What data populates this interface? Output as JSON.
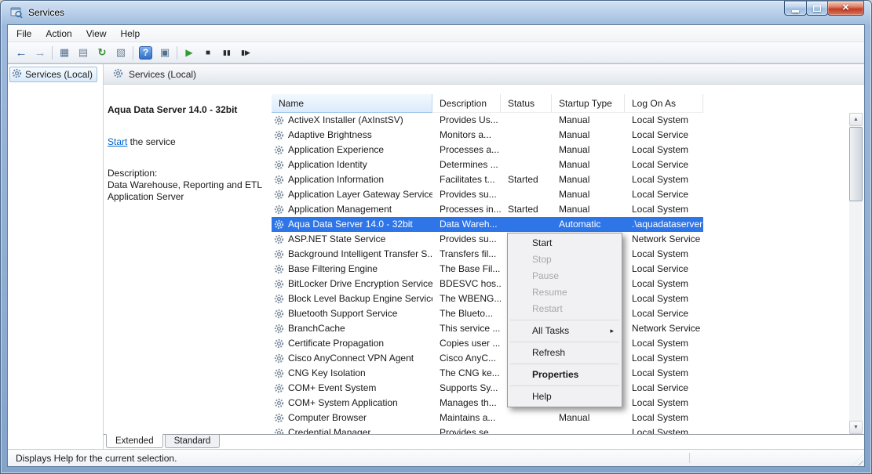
{
  "colors": {
    "selection": "#2e76e8",
    "link": "#0066cc"
  },
  "window": {
    "title": "Services"
  },
  "menu_bar": {
    "items": [
      "File",
      "Action",
      "View",
      "Help"
    ]
  },
  "toolbar": {
    "icons": [
      {
        "name": "back-icon",
        "glyph": "←",
        "color": "#2c5f9e"
      },
      {
        "name": "forward-icon",
        "glyph": "→",
        "color": "#8fa3b8"
      },
      {
        "name": "separator"
      },
      {
        "name": "show-console-tree-icon",
        "glyph": "▦",
        "color": "#55718f"
      },
      {
        "name": "export-list-icon",
        "glyph": "▤",
        "color": "#6d8097"
      },
      {
        "name": "refresh-icon",
        "glyph": "↻",
        "color": "#2e8b2e"
      },
      {
        "name": "properties-icon",
        "glyph": "▧",
        "color": "#6d8097"
      },
      {
        "name": "separator"
      },
      {
        "name": "help-icon",
        "glyph": "?",
        "color": "#ffffff"
      },
      {
        "name": "display-icon",
        "glyph": "▣",
        "color": "#55718f"
      },
      {
        "name": "separator"
      },
      {
        "name": "start-service-icon",
        "glyph": "▶",
        "color": "#2f9e2f"
      },
      {
        "name": "stop-service-icon",
        "glyph": "■",
        "color": "#2b2b2b"
      },
      {
        "name": "pause-service-icon",
        "glyph": "▮▮",
        "color": "#2b2b2b"
      },
      {
        "name": "restart-service-icon",
        "glyph": "▮▶",
        "color": "#2b2b2b"
      }
    ]
  },
  "console_tree": {
    "root_label": "Services (Local)"
  },
  "panel": {
    "header": "Services (Local)",
    "info": {
      "title": "Aqua Data Server 14.0 - 32bit",
      "action_link": "Start",
      "action_rest": " the service",
      "description_label": "Description:",
      "description_text": "Data Warehouse, Reporting and ETL Application Server"
    }
  },
  "table": {
    "columns": [
      {
        "label": "Name",
        "sorted": true
      },
      {
        "label": "Description"
      },
      {
        "label": "Status"
      },
      {
        "label": "Startup Type"
      },
      {
        "label": "Log On As"
      }
    ],
    "selected_index": 7,
    "rows": [
      {
        "name": "ActiveX Installer (AxInstSV)",
        "description": "Provides Us...",
        "status": "",
        "startup": "Manual",
        "logon": "Local System"
      },
      {
        "name": "Adaptive Brightness",
        "description": "Monitors a...",
        "status": "",
        "startup": "Manual",
        "logon": "Local Service"
      },
      {
        "name": "Application Experience",
        "description": "Processes a...",
        "status": "",
        "startup": "Manual",
        "logon": "Local System"
      },
      {
        "name": "Application Identity",
        "description": "Determines ...",
        "status": "",
        "startup": "Manual",
        "logon": "Local Service"
      },
      {
        "name": "Application Information",
        "description": "Facilitates t...",
        "status": "Started",
        "startup": "Manual",
        "logon": "Local System"
      },
      {
        "name": "Application Layer Gateway Service",
        "description": "Provides su...",
        "status": "",
        "startup": "Manual",
        "logon": "Local Service"
      },
      {
        "name": "Application Management",
        "description": "Processes in...",
        "status": "Started",
        "startup": "Manual",
        "logon": "Local System"
      },
      {
        "name": "Aqua Data Server 14.0 - 32bit",
        "description": "Data Wareh...",
        "status": "",
        "startup": "Automatic",
        "logon": ".\\aquadataserver"
      },
      {
        "name": "ASP.NET State Service",
        "description": "Provides su...",
        "status": "",
        "startup": "",
        "logon": "Network Service"
      },
      {
        "name": "Background Intelligent Transfer S...",
        "description": "Transfers fil...",
        "status": "",
        "startup": "",
        "logon": "Local System"
      },
      {
        "name": "Base Filtering Engine",
        "description": "The Base Fil...",
        "status": "",
        "startup": "",
        "logon": "Local Service"
      },
      {
        "name": "BitLocker Drive Encryption Service",
        "description": "BDESVC hos...",
        "status": "",
        "startup": "",
        "logon": "Local System"
      },
      {
        "name": "Block Level Backup Engine Service",
        "description": "The WBENG...",
        "status": "",
        "startup": "",
        "logon": "Local System"
      },
      {
        "name": "Bluetooth Support Service",
        "description": "The Blueto...",
        "status": "",
        "startup": "",
        "logon": "Local Service"
      },
      {
        "name": "BranchCache",
        "description": "This service ...",
        "status": "",
        "startup": "",
        "logon": "Network Service"
      },
      {
        "name": "Certificate Propagation",
        "description": "Copies user ...",
        "status": "",
        "startup": "",
        "logon": "Local System"
      },
      {
        "name": "Cisco AnyConnect VPN Agent",
        "description": "Cisco AnyC...",
        "status": "",
        "startup": "",
        "logon": "Local System"
      },
      {
        "name": "CNG Key Isolation",
        "description": "The CNG ke...",
        "status": "",
        "startup": "",
        "logon": "Local System"
      },
      {
        "name": "COM+ Event System",
        "description": "Supports Sy...",
        "status": "",
        "startup": "",
        "logon": "Local Service"
      },
      {
        "name": "COM+ System Application",
        "description": "Manages th...",
        "status": "",
        "startup": "",
        "logon": "Local System"
      },
      {
        "name": "Computer Browser",
        "description": "Maintains a...",
        "status": "",
        "startup": "Manual",
        "logon": "Local System"
      },
      {
        "name": "Credential Manager",
        "description": "Provides se...",
        "status": "",
        "startup": "",
        "logon": "Local System"
      }
    ]
  },
  "context_menu": {
    "items": [
      {
        "label": "Start",
        "enabled": true
      },
      {
        "label": "Stop",
        "enabled": false
      },
      {
        "label": "Pause",
        "enabled": false
      },
      {
        "label": "Resume",
        "enabled": false
      },
      {
        "label": "Restart",
        "enabled": false
      },
      {
        "type": "separator"
      },
      {
        "label": "All Tasks",
        "enabled": true,
        "submenu": true
      },
      {
        "type": "separator"
      },
      {
        "label": "Refresh",
        "enabled": true
      },
      {
        "type": "separator"
      },
      {
        "label": "Properties",
        "enabled": true,
        "bold": true
      },
      {
        "type": "separator"
      },
      {
        "label": "Help",
        "enabled": true
      }
    ]
  },
  "tabs": [
    {
      "label": "Extended",
      "selected": true
    },
    {
      "label": "Standard",
      "selected": false
    }
  ],
  "status_bar": {
    "text": "Displays Help for the current selection."
  }
}
